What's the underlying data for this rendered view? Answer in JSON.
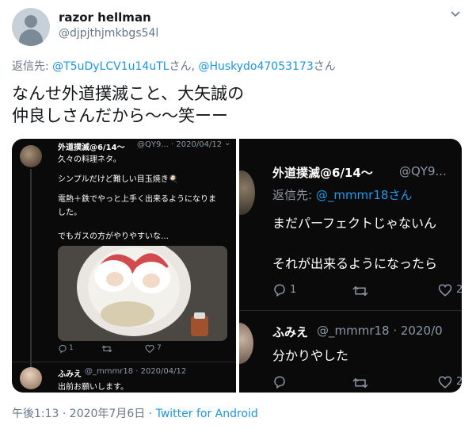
{
  "user": {
    "name": "razor hellman",
    "handle": "@djpjthjmkbgs54l"
  },
  "reply_to": {
    "label": "返信先: ",
    "user1": "@T5uDyLCV1u14uTL",
    "sep": "さん, ",
    "user2": "@Huskydo47053173",
    "suffix": "さん"
  },
  "tweet": {
    "line1": "なんせ外道撲滅こと、大矢誠の",
    "line2": "仲良しさんだから〜〜笑ーー"
  },
  "left_shot": {
    "author_name": "外道撲滅@6/14〜",
    "author_meta": "@QY9... · 2020/04/12",
    "lines": [
      "久々の料理ネタ。",
      "シンプルだけど難しい目玉焼き🍳",
      "電熱＋鉄でやっと上手く出来るようになりま",
      "した。",
      "でもガスの方がやりやすいな…"
    ],
    "replies_count": "1",
    "likes_count": "7",
    "reply_name": "ふみえ",
    "reply_meta": "@_mmmr18 · 2020/04/12",
    "reply_text": "出前お願いします。"
  },
  "right_shot": {
    "author_name": "外道撲滅@6/14〜",
    "author_handle": "@QY9...",
    "reply_label": "返信先: ",
    "reply_user": "@_mmmr18さん",
    "line1": "まだパーフェクトじゃないん",
    "line2": "それが出来るようになったら",
    "reply_count": "1",
    "like_count": "2",
    "reply_name": "ふみえ",
    "reply_meta": "@_mmmr18 · 2020/0",
    "reply_text": "分かりやした",
    "like_count2": "2"
  },
  "meta": {
    "time": "午後1:13 · 2020年7月6日 · ",
    "source": "Twitter for Android"
  },
  "colors": {
    "link": "#1b95e0",
    "meta": "#657786",
    "dark_bg": "#0a0a0a"
  },
  "icons": [
    "chevron-down-icon",
    "reply-icon",
    "retweet-icon",
    "like-icon"
  ]
}
